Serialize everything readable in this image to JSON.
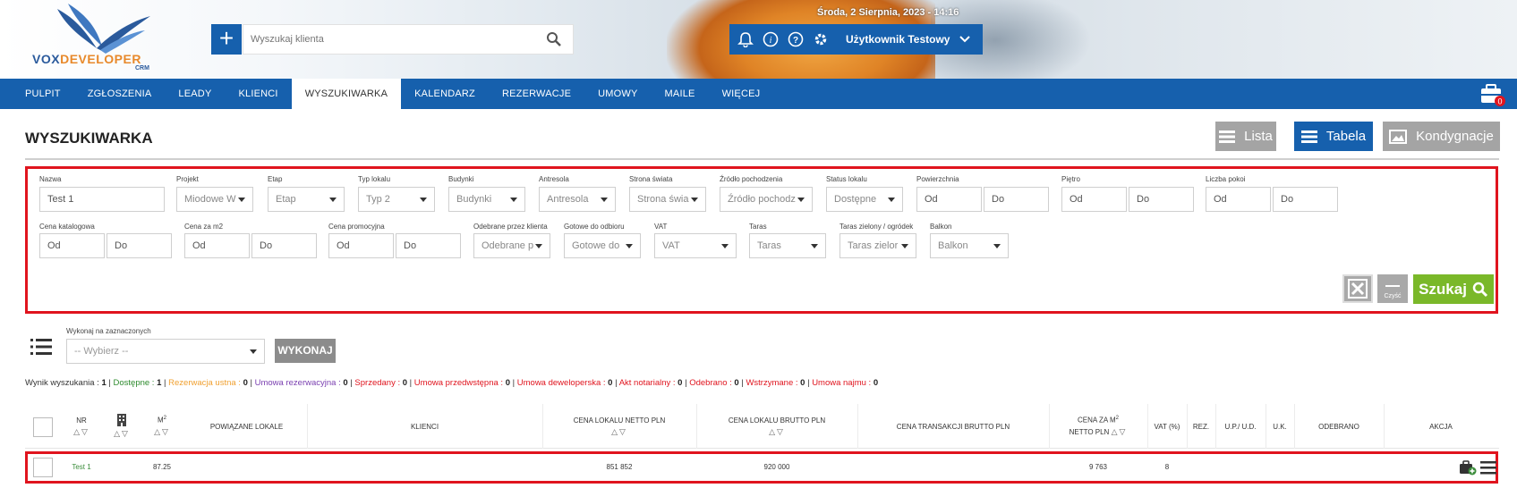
{
  "header": {
    "logo": {
      "brand_a": "VOX",
      "brand_b": "DEVELOPER",
      "sub": "CRM"
    },
    "search_placeholder": "Wyszukaj klienta",
    "datetime": "Środa, 2 Sierpnia, 2023 - 14:16",
    "user_name": "Użytkownik Testowy",
    "icons": [
      "plus-icon",
      "search-icon",
      "bell-icon",
      "info-icon",
      "help-icon",
      "gear-icon",
      "chevron-down-icon"
    ]
  },
  "nav": {
    "items": [
      "PULPIT",
      "ZGŁOSZENIA",
      "LEADY",
      "KLIENCI",
      "WYSZUKIWARKA",
      "KALENDARZ",
      "REZERWACJE",
      "UMOWY",
      "MAILE",
      "WIĘCEJ"
    ],
    "active": "WYSZUKIWARKA",
    "cart_badge": "0"
  },
  "page": {
    "title": "WYSZUKIWARKA",
    "views": {
      "lista": "Lista",
      "tabela": "Tabela",
      "kondygnacje": "Kondygnacje"
    }
  },
  "filters": {
    "row1": {
      "nazwa": {
        "label": "Nazwa",
        "value": "Test 1"
      },
      "projekt": {
        "label": "Projekt",
        "value": "Miodowe W"
      },
      "etap": {
        "label": "Etap",
        "value": "Etap"
      },
      "typ": {
        "label": "Typ lokalu",
        "value": "Typ 2"
      },
      "budynki": {
        "label": "Budynki",
        "value": "Budynki"
      },
      "antresola": {
        "label": "Antresola",
        "value": "Antresola"
      },
      "strona": {
        "label": "Strona świata",
        "value": "Strona świa"
      },
      "zrodlo": {
        "label": "Źródło pochodzenia",
        "value": "Źródło pochodz"
      },
      "status": {
        "label": "Status lokalu",
        "value": "Dostępne"
      },
      "powierzchnia": {
        "label": "Powierzchnia",
        "od": "Od",
        "do": "Do"
      },
      "pietro": {
        "label": "Piętro",
        "od": "Od",
        "do": "Do"
      },
      "pokoje": {
        "label": "Liczba pokoi",
        "od": "Od",
        "do": "Do"
      }
    },
    "row2": {
      "cena_kat": {
        "label": "Cena katalogowa",
        "od": "Od",
        "do": "Do"
      },
      "cena_m2": {
        "label": "Cena za m2",
        "od": "Od",
        "do": "Do"
      },
      "cena_promo": {
        "label": "Cena promocyjna",
        "od": "Od",
        "do": "Do"
      },
      "odebrane": {
        "label": "Odebrane przez klienta",
        "value": "Odebrane p"
      },
      "gotowe": {
        "label": "Gotowe do odbioru",
        "value": "Gotowe do"
      },
      "vat": {
        "label": "VAT",
        "value": "VAT"
      },
      "taras": {
        "label": "Taras",
        "value": "Taras"
      },
      "taras_ziel": {
        "label": "Taras zielony / ogródek",
        "value": "Taras zielor"
      },
      "balkon": {
        "label": "Balkon",
        "value": "Balkon"
      }
    },
    "actions": {
      "clear_small": "Czyść",
      "search": "Szukaj"
    }
  },
  "bulk": {
    "label": "Wykonaj na zaznaczonych",
    "placeholder": "-- Wybierz --",
    "button": "WYKONAJ"
  },
  "summary": {
    "prefix": "Wynik wyszukania :",
    "total": "1",
    "items": [
      {
        "label": "Dostępne :",
        "value": "1",
        "color": "#2e8b2e"
      },
      {
        "label": "Rezerwacja ustna :",
        "value": "0",
        "color": "#f0a030"
      },
      {
        "label": "Umowa rezerwacyjna :",
        "value": "0",
        "color": "#7a3fb0"
      },
      {
        "label": "Sprzedany :",
        "value": "0",
        "color": "#e0141e"
      },
      {
        "label": "Umowa przedwstępna :",
        "value": "0",
        "color": "#e0141e"
      },
      {
        "label": "Umowa deweloperska :",
        "value": "0",
        "color": "#e0141e"
      },
      {
        "label": "Akt notarialny :",
        "value": "0",
        "color": "#e0141e"
      },
      {
        "label": "Odebrano :",
        "value": "0",
        "color": "#e0141e"
      },
      {
        "label": "Wstrzymane :",
        "value": "0",
        "color": "#e0141e"
      },
      {
        "label": "Umowa najmu :",
        "value": "0",
        "color": "#e0141e"
      }
    ]
  },
  "table": {
    "headers": {
      "nr": "NR",
      "m2": "M",
      "m2_sup": "2",
      "powiazane": "POWIĄZANE LOKALE",
      "klienci": "KLIENCI",
      "cena_netto": "CENA LOKALU NETTO PLN",
      "cena_brutto": "CENA LOKALU BRUTTO PLN",
      "cena_trans": "CENA TRANSAKCJI BRUTTO PLN",
      "cena_m2_a": "CENA ZA M",
      "cena_m2_sup": "2",
      "cena_m2_b": "NETTO PLN",
      "vat": "VAT (%)",
      "rez": "REZ.",
      "up": "U.P./ U.D.",
      "uk": "U.K.",
      "odebrano": "ODEBRANO",
      "akcja": "AKCJA"
    },
    "rows": [
      {
        "nr": "Test 1",
        "m2": "87.25",
        "cena_netto": "851 852",
        "cena_brutto": "920 000",
        "cena_m2": "9 763",
        "vat": "8"
      }
    ]
  }
}
